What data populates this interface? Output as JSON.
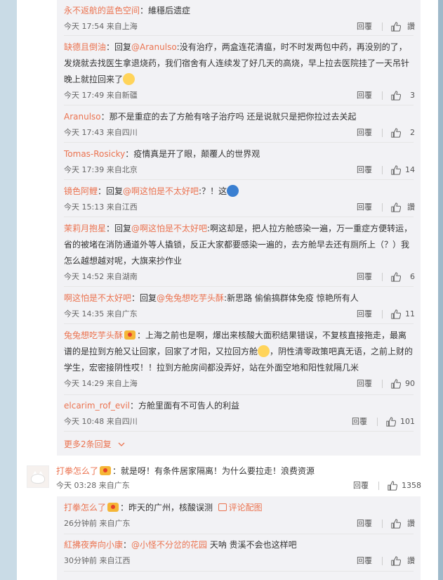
{
  "icons": {
    "like": "thumbs-up-icon",
    "more": "chevron-down-icon",
    "link": "picture-link-icon",
    "emoji": "face-emoji-icon",
    "badge": "user-badge-icon"
  },
  "labels": {
    "reply": "回覆",
    "like_default": "讚"
  },
  "comments": [
    {
      "user": "永不返航的蓝色空间",
      "text": "：維穩后遗症",
      "time": "今天 17:54 来自上海",
      "likes": "讚"
    },
    {
      "user": "缺德且倒油",
      "reply_to": "@Aranulso",
      "text_a": ":没有治疗，两盒连花清瘟，时不时发两包中药，再没别的了，发烧就去找医生拿退烧药，我们宿舍有人连续发了好几天的高烧，早上拉去医院挂了一天吊针晚上就拉回来了",
      "time": "今天 17:49 来自新疆",
      "likes": "3"
    },
    {
      "user": "Aranulso",
      "text": "：那不是重症的去了方舱有啥子治疗吗 还是说就只是把你拉过去关起",
      "time": "今天 17:43 来自四川",
      "likes": "2"
    },
    {
      "user": "Tomas-Rosicky",
      "text": "：疫情真是开了眼，颠覆人的世界观",
      "time": "今天 17:39 来自北京",
      "likes": "14"
    },
    {
      "user": "镜色阿鲤",
      "reply_to": "@啊这怕是不太好吧",
      "text_a": ":？！这",
      "time": "今天 15:13 来自江西",
      "likes": "讚"
    },
    {
      "user": "茉莉月抱星",
      "reply_to": "@啊这怕是不太好吧",
      "text_a": ":啊这却是，把人拉方舱感染一遍，万一重症方便转运，省的被堵在消防通道外等人撬锁，反正大家都要感染一遍的，去方舱早去还有厕所上（？）我怎么越想越对呢，大旗来抄作业",
      "time": "今天 14:52 来自湖南",
      "likes": "6"
    },
    {
      "user": "啊这怕是不太好吧",
      "reply_to": "@兔兔想吃芋头酥",
      "text_a": ":新思路 偷偷搞群体免疫 惊艳所有人",
      "time": "今天 14:35 来自广东",
      "likes": "11"
    },
    {
      "user": "兔兔想吃芋头酥",
      "text_a": "：上海之前也是啊，爆出来核酸大面积结果错误，不复核直接拖走，最离谱的是拉到方舱又让回家，回家了才阳，又拉回方舱",
      "text_b": "，阴性清零政策吧真无语，之前上财的学生，宏密接阴性哎！！拉到方舱房间都没弄好，站在外面空地和阳性就隔几米",
      "time": "今天 14:29 来自上海",
      "likes": "90"
    },
    {
      "user": "elcarim_rof_evil",
      "text": "：方舱里面有不可告人的利益",
      "time": "今天 10:48 来自四川",
      "likes": "101"
    }
  ],
  "more_replies": "更多2条回复",
  "main": {
    "user": "打拳怎么了",
    "text": "：就是呀！有条件居家隔离！为什么要拉走！浪费资源",
    "time": "今天 03:28 来自广东",
    "likes": "1358"
  },
  "subs": [
    {
      "user": "打拳怎么了",
      "text": "：昨天的广州，核酸误测",
      "link": "评论配图",
      "time": "26分钟前 来自广东",
      "likes": "讚"
    },
    {
      "user": "紅拂夜奔向小康",
      "reply_to": "@小怪不分岔的花园",
      "text": " 天呐 贵溪不会也这样吧",
      "time": "30分钟前 来自江西",
      "likes": "讚"
    }
  ]
}
